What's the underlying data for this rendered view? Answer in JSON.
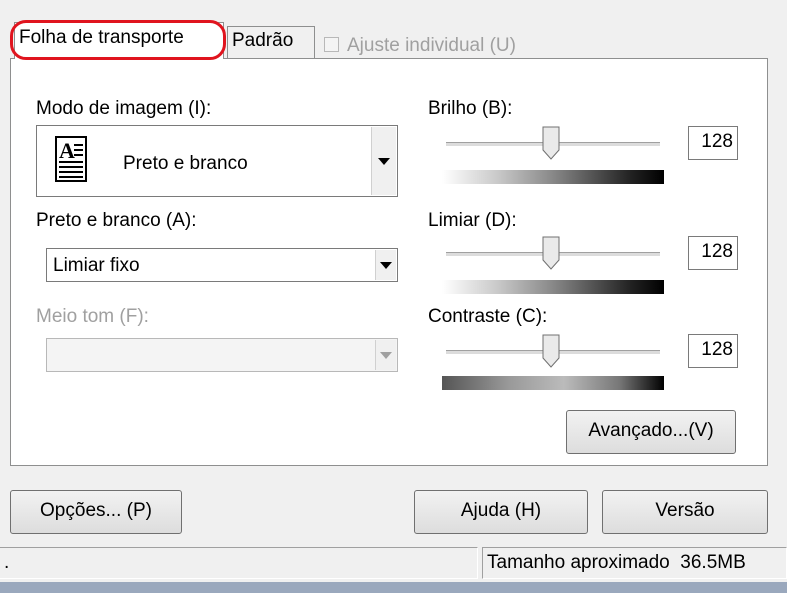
{
  "tabs": [
    {
      "label": "Folha de transporte"
    },
    {
      "label": "Padrão"
    }
  ],
  "individual": {
    "label": "Ajuste individual (U)",
    "checked": false
  },
  "image_mode": {
    "label": "Modo de imagem (I):",
    "value": "Preto e branco",
    "icon": "document-text-icon"
  },
  "bw": {
    "label": "Preto e branco (A):",
    "value": "Limiar fixo"
  },
  "halftone": {
    "label": "Meio tom (F):",
    "value": ""
  },
  "brightness": {
    "label": "Brilho (B):",
    "value": "128"
  },
  "threshold": {
    "label": "Limiar (D):",
    "value": "128"
  },
  "contrast": {
    "label": "Contraste (C):",
    "value": "128"
  },
  "buttons": {
    "advanced": "Avançado...(V)",
    "options": "Opções... (P)",
    "help": "Ajuda (H)",
    "version": "Versão"
  },
  "status": {
    "left": ".",
    "size": "Tamanho aproximado  36.5MB"
  },
  "colors": {
    "highlight": "#e0141e",
    "panel": "#ffffff",
    "window": "#f0f0f0"
  }
}
